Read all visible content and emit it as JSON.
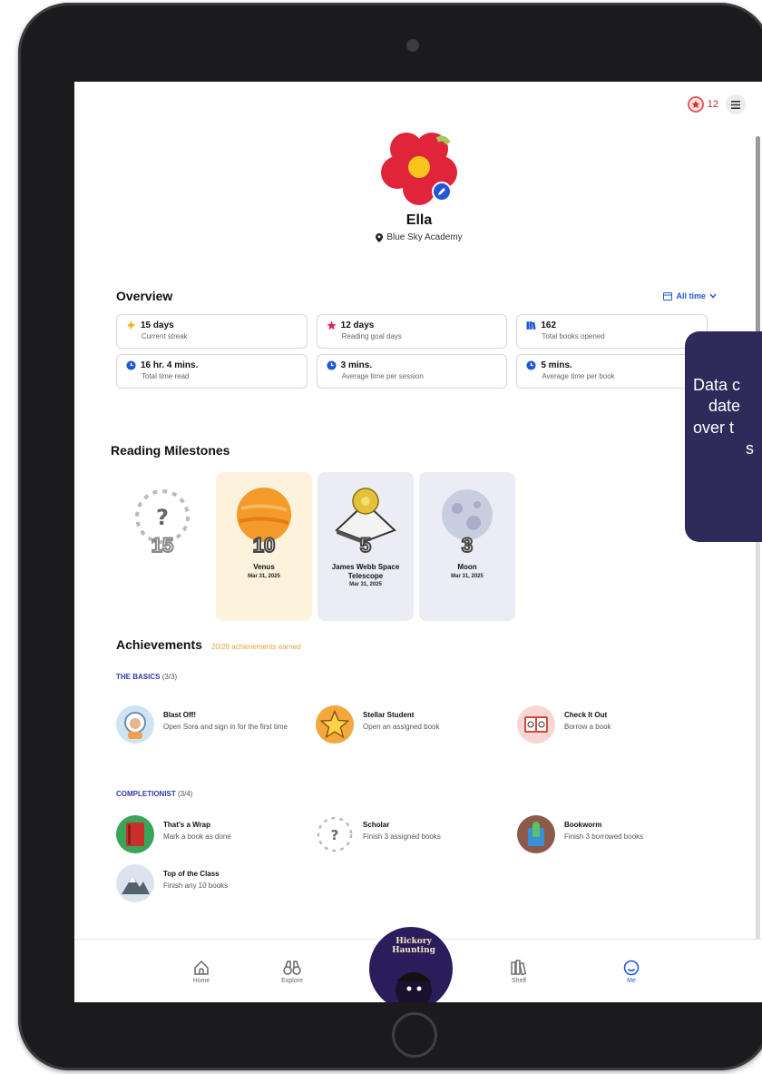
{
  "header": {
    "star_count": "12"
  },
  "profile": {
    "name": "Ella",
    "school": "Blue Sky Academy"
  },
  "overview": {
    "title": "Overview",
    "filter": "All time",
    "stats": [
      {
        "value": "15 days",
        "label": "Current streak",
        "icon": "lightning-icon",
        "color": "#f5b400"
      },
      {
        "value": "12 days",
        "label": "Reading goal days",
        "icon": "star-icon",
        "color": "#e0245e"
      },
      {
        "value": "162",
        "label": "Total books opened",
        "icon": "books-icon",
        "color": "#2157d6"
      },
      {
        "value": "16 hr. 4 mins.",
        "label": "Total time read",
        "icon": "clock-icon",
        "color": "#2157d6"
      },
      {
        "value": "3 mins.",
        "label": "Average time per session",
        "icon": "clock-icon",
        "color": "#2157d6"
      },
      {
        "value": "5 mins.",
        "label": "Average time per book",
        "icon": "clock-icon",
        "color": "#2157d6"
      }
    ]
  },
  "milestones": {
    "title": "Reading Milestones",
    "items": [
      {
        "number": "15",
        "name": "",
        "date": "",
        "locked": true
      },
      {
        "number": "10",
        "name": "Venus",
        "date": "Mar 31, 2025"
      },
      {
        "number": "5",
        "name": "James Webb Space Telescope",
        "date": "Mar 31, 2025"
      },
      {
        "number": "3",
        "name": "Moon",
        "date": "Mar 31, 2025"
      }
    ]
  },
  "achievements": {
    "title": "Achievements",
    "count": "20/29 achievements earned",
    "basics": {
      "label": "THE BASICS",
      "progress": "(3/3)",
      "items": [
        {
          "name": "Blast Off!",
          "desc": "Open Sora and sign in for the first time"
        },
        {
          "name": "Stellar Student",
          "desc": "Open an assigned book"
        },
        {
          "name": "Check It Out",
          "desc": "Borrow a book"
        }
      ]
    },
    "completionist": {
      "label": "COMPLETIONIST",
      "progress": "(3/4)",
      "items": [
        {
          "name": "That's a Wrap",
          "desc": "Mark a book as done"
        },
        {
          "name": "Scholar",
          "desc": "Finish 3 assigned books"
        },
        {
          "name": "Bookworm",
          "desc": "Finish 3 borrowed books"
        },
        {
          "name": "Top of the Class",
          "desc": "Finish any 10 books"
        }
      ]
    }
  },
  "nav": {
    "home": "Home",
    "explore": "Explore",
    "book_title": "Hickory Haunting",
    "shelf": "Shelf",
    "me": "Me"
  },
  "tooltip": {
    "line1": "Data c",
    "line2": "date",
    "line3": "over t",
    "line4": "s"
  }
}
